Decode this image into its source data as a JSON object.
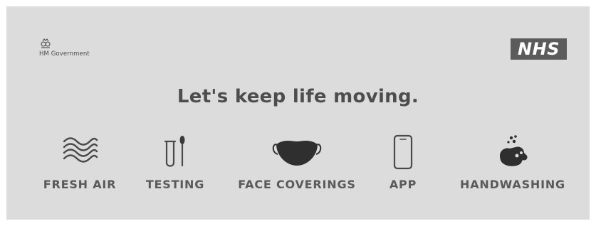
{
  "government": {
    "logo_text": "HM Government"
  },
  "nhs": {
    "logo_text": "NHS"
  },
  "headline": "Let's keep life moving.",
  "items": [
    {
      "label": "FRESH AIR",
      "icon": "fresh-air-icon"
    },
    {
      "label": "TESTING",
      "icon": "test-tube-icon"
    },
    {
      "label": "FACE COVERINGS",
      "icon": "face-mask-icon"
    },
    {
      "label": "APP",
      "icon": "smartphone-icon"
    },
    {
      "label": "HANDWASHING",
      "icon": "handwashing-icon"
    }
  ],
  "colors": {
    "background": "#dcdcdc",
    "text": "#4b4b4b",
    "icon": "#3a3a3a"
  }
}
